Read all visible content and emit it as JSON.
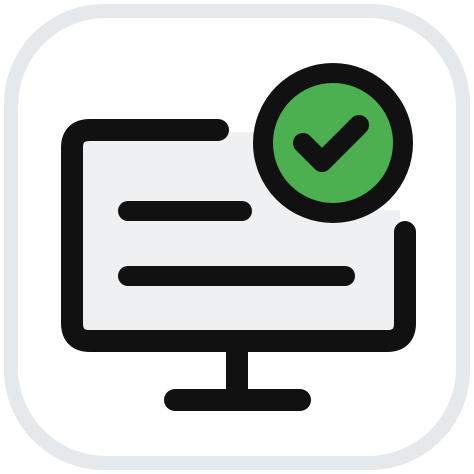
{
  "icon": {
    "name": "monitor-check-icon",
    "colors": {
      "tile_border": "#e5e9ec",
      "tile_fill": "#ffffff",
      "screen_fill": "#eef0f2",
      "stroke": "#111111",
      "check_fill": "#4caf50",
      "check_mark": "#111111"
    }
  }
}
